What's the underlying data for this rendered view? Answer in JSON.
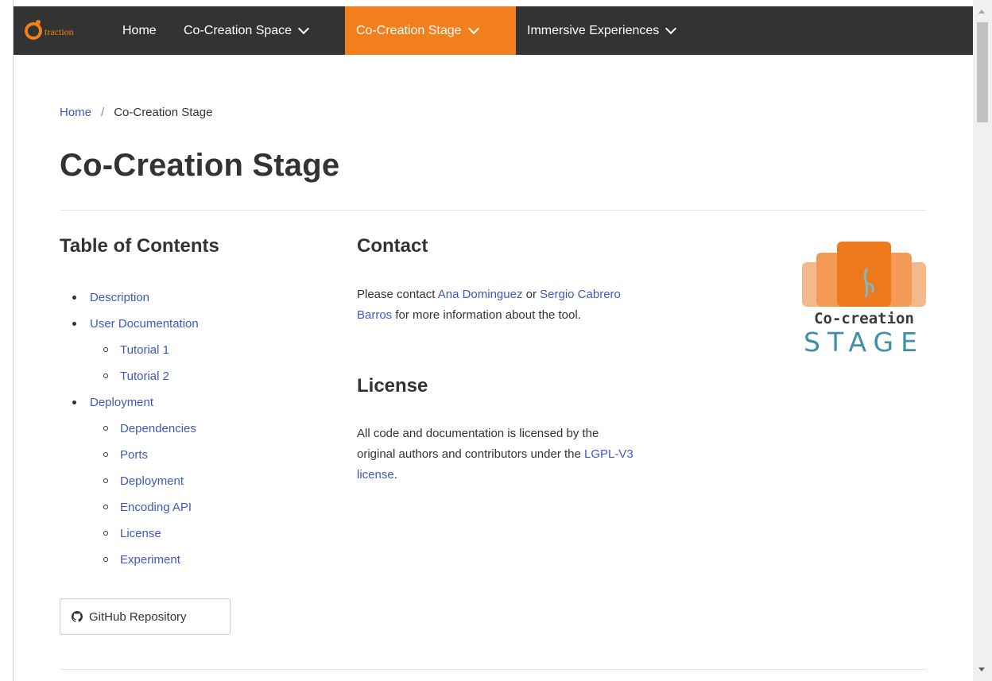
{
  "nav": {
    "brand": "traction",
    "items": [
      {
        "label": "Home"
      },
      {
        "label": "Co-Creation Space"
      },
      {
        "label": "Co-Creation Stage"
      },
      {
        "label": "Immersive Experiences"
      }
    ],
    "active_color": "#f07f1c",
    "bar_color": "#333333"
  },
  "breadcrumb": {
    "home": "Home",
    "separator": "/",
    "current": "Co-Creation Stage"
  },
  "page_title": "Co-Creation Stage",
  "toc": {
    "title": "Table of Contents",
    "items": [
      {
        "label": "Description"
      },
      {
        "label": "User Documentation",
        "children": [
          {
            "label": "Tutorial 1"
          },
          {
            "label": "Tutorial 2"
          }
        ]
      },
      {
        "label": "Deployment",
        "children": [
          {
            "label": "Dependencies"
          },
          {
            "label": "Ports"
          },
          {
            "label": "Deployment"
          },
          {
            "label": "Encoding API"
          },
          {
            "label": "License"
          },
          {
            "label": "Experiment"
          }
        ]
      }
    ]
  },
  "github_button": {
    "label": "GitHub Repository",
    "icon": "github-icon"
  },
  "contact": {
    "title": "Contact",
    "text_before": "Please contact ",
    "link1": "Ana Dominguez",
    "text_middle": " or ",
    "link2": "Sergio Cabrero Barros",
    "text_after": " for more information about the tool."
  },
  "license": {
    "title": "License",
    "text_before": "All code and documentation is licensed by the original authors and contributors under the ",
    "link": "LGPL-V3 license",
    "text_after": "."
  },
  "logo": {
    "line1": "Co-creation",
    "line2": "STAGE"
  },
  "link_color": "#3f59c0"
}
